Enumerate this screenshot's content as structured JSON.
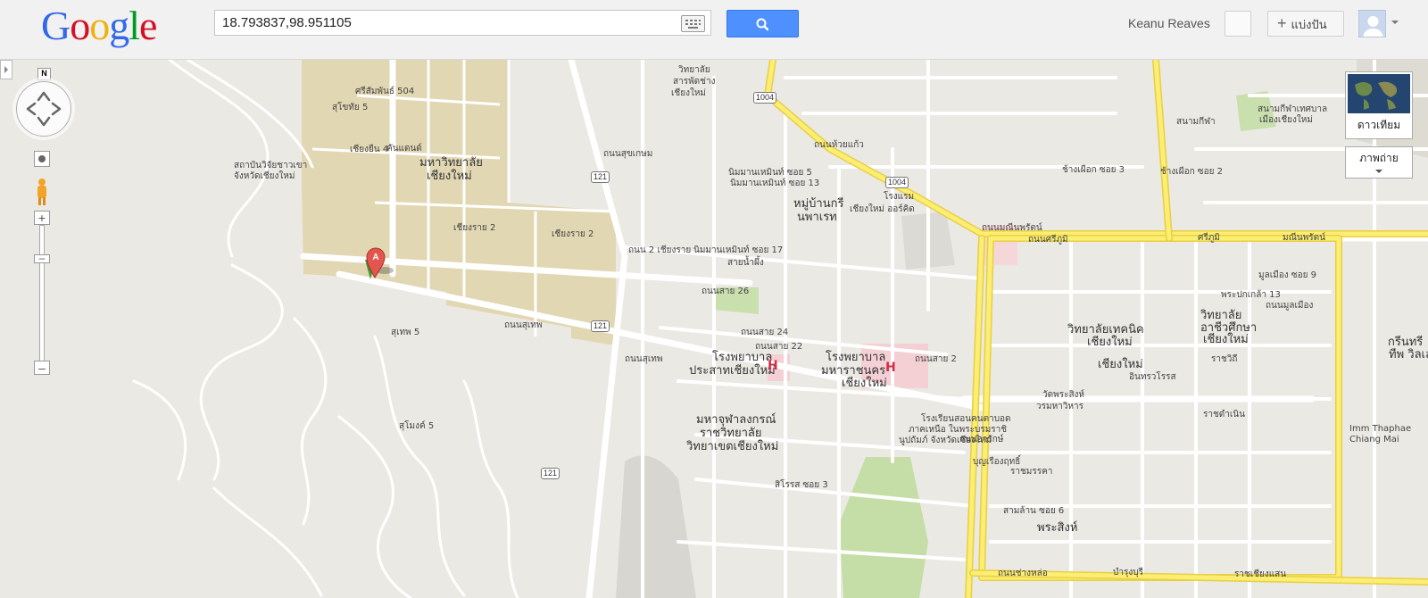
{
  "header": {
    "logo_text": "Google",
    "search_value": "18.793837,98.951105",
    "user_name": "Keanu Reaves",
    "share_label": "แบ่งปัน"
  },
  "map_controls": {
    "north_label": "N",
    "satellite_label": "ดาวเทียม",
    "photos_label": "ภาพถ่าย"
  },
  "markers": [
    {
      "label": "A",
      "color": "#d14836"
    }
  ],
  "labels": [
    {
      "t": "ศรีสัมพันธ์ 504"
    },
    {
      "t": "สุโขทัย 5"
    },
    {
      "t": "เชียงยืน 4"
    },
    {
      "t": "คันแดนด์"
    },
    {
      "t": "สถาบันวิจัยชาวเขา"
    },
    {
      "t": "จังหวัดเชียงใหม่"
    },
    {
      "t": "มหาวิทยาลัย"
    },
    {
      "t": "เชียงใหม่"
    },
    {
      "t": "เชียงราย 2"
    },
    {
      "t": "เชียงราย 2"
    },
    {
      "t": "วิทยาลัย"
    },
    {
      "t": "สารพัดช่าง"
    },
    {
      "t": "เชียงใหม่"
    },
    {
      "t": "ถนนสุเทพ"
    },
    {
      "t": "ถนนสุเทพ"
    },
    {
      "t": "สุเทพ 5"
    },
    {
      "t": "สุโมงค์ 5"
    },
    {
      "t": "ถนน 2 เชียงราย"
    },
    {
      "t": "ถนนสุขเกษม"
    },
    {
      "t": "ถนนห้วยแก้ว"
    },
    {
      "t": "นิมมานเหมินท์ ซอย 5"
    },
    {
      "t": "นิมมานเหมินท์ ซอย 13"
    },
    {
      "t": "หมู่บ้านกรี"
    },
    {
      "t": "นพาเรท"
    },
    {
      "t": "นิมมานเหมินท์ ซอย 17"
    },
    {
      "t": "สายน้ำผึ้ง"
    },
    {
      "t": "ถนนสาย 26"
    },
    {
      "t": "ถนนสาย 24"
    },
    {
      "t": "ถนนสาย 22"
    },
    {
      "t": "ถนนสาย 2"
    },
    {
      "t": "โรงพยาบาล"
    },
    {
      "t": "ประสาทเชียงใหม่"
    },
    {
      "t": "โรงพยาบาล"
    },
    {
      "t": "มหาราชนคร"
    },
    {
      "t": "เชียงใหม่"
    },
    {
      "t": "มหาจุฬาลงกรณ์"
    },
    {
      "t": "ราชวิทยาลัย"
    },
    {
      "t": "วิทยาเขตเชียงใหม่"
    },
    {
      "t": "โรงแรม"
    },
    {
      "t": "เชียงใหม่ ออร์คิด"
    },
    {
      "t": "ถนนมณีนพรัตน์"
    },
    {
      "t": "มณีนพรัตน์"
    },
    {
      "t": "ถนนศรีภูมิ"
    },
    {
      "t": "ศรีภูมิ"
    },
    {
      "t": "สนามกีฬา"
    },
    {
      "t": "ช้างเผือก ซอย 2"
    },
    {
      "t": "ช้างเผือก ซอย 3"
    },
    {
      "t": "วิทยาลัยเทคนิค"
    },
    {
      "t": "เชียงใหม่"
    },
    {
      "t": "วิทยาลัย"
    },
    {
      "t": "อาชีวศึกษา"
    },
    {
      "t": "เชียงใหม่"
    },
    {
      "t": "เชียงใหม่"
    },
    {
      "t": "ราชดำเนิน"
    },
    {
      "t": "พระปกเกล้า 13"
    },
    {
      "t": "มูลเมือง ซอย 9"
    },
    {
      "t": "ราชวิถี"
    },
    {
      "t": "อินทรวโรรส"
    },
    {
      "t": "วัดพระสิงห์"
    },
    {
      "t": "วรมหาวิหาร"
    },
    {
      "t": "โรงเรียนสอนคนตาบอด"
    },
    {
      "t": "ภาคเหนือ ในพระบรมราชิ"
    },
    {
      "t": "นูปถัมภ์ จังหวัดเชียงใหม่"
    },
    {
      "t": "ราชมรรคา"
    },
    {
      "t": "สามล้าน ซอย 6"
    },
    {
      "t": "พระสิงห์"
    },
    {
      "t": "ถนนช่างหล่อ"
    },
    {
      "t": "บำรุงบุรี"
    },
    {
      "t": "ราชเชียงแสน"
    },
    {
      "t": "สิโรรส ซอย 3"
    },
    {
      "t": "กรีนทรี"
    },
    {
      "t": "ทีพ วิลเลจ"
    },
    {
      "t": "Imm Thaphae"
    },
    {
      "t": "Chiang Mai"
    },
    {
      "t": "สนามกีฬาเทศบาล"
    },
    {
      "t": "เมืองเชียงใหม่"
    },
    {
      "t": "ถนนอารักษ์"
    },
    {
      "t": "บุญเรืองฤทธิ์"
    },
    {
      "t": "ถนนมูลเมือง"
    }
  ],
  "route_shields": [
    "1004",
    "1004",
    "121",
    "121",
    "121"
  ]
}
